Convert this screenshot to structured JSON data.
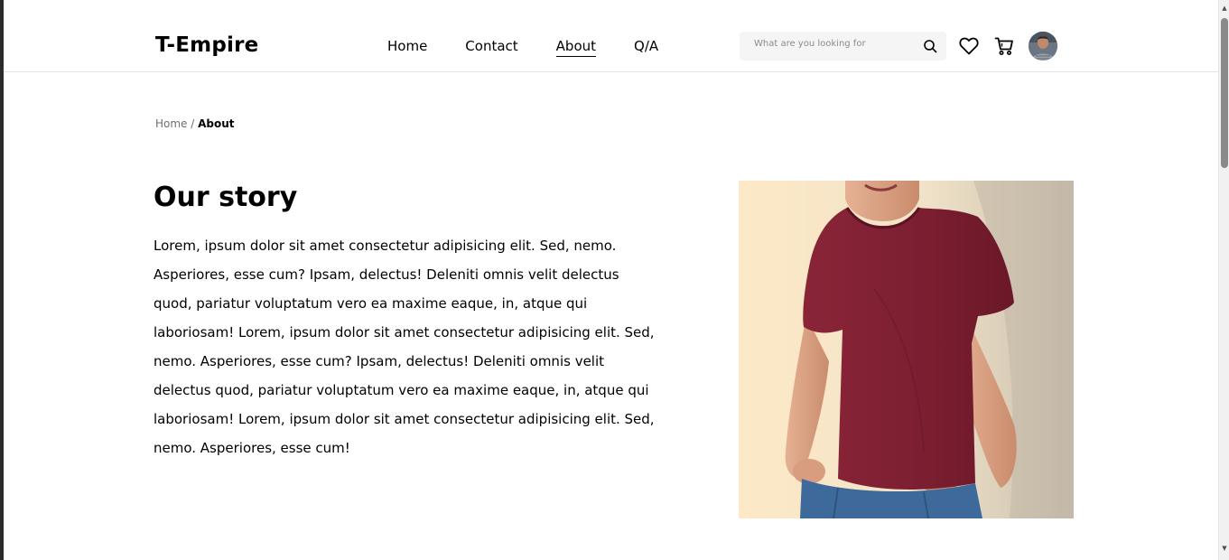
{
  "header": {
    "logo": "T-Empire",
    "nav": [
      {
        "label": "Home",
        "active": false
      },
      {
        "label": "Contact",
        "active": false
      },
      {
        "label": "About",
        "active": true
      },
      {
        "label": "Q/A",
        "active": false
      }
    ],
    "search": {
      "placeholder": "What are you looking for",
      "icon": "search-icon"
    },
    "icons": [
      "heart-icon",
      "cart-icon"
    ],
    "avatar": "user-avatar"
  },
  "breadcrumb": {
    "home": "Home",
    "separator": " / ",
    "current": "About"
  },
  "story": {
    "title": "Our story",
    "body": "Lorem, ipsum dolor sit amet consectetur adipisicing elit. Sed, nemo. Asperiores, esse cum? Ipsam, delectus! Deleniti omnis velit delectus quod, pariatur voluptatum vero ea maxime eaque, in, atque qui laboriosam! Lorem, ipsum dolor sit amet consectetur adipisicing elit. Sed, nemo. Asperiores, esse cum? Ipsam, delectus! Deleniti omnis velit delectus quod, pariatur voluptatum vero ea maxime eaque, in, atque qui laboriosam! Lorem, ipsum dolor sit amet consectetur adipisicing elit. Sed, nemo. Asperiores, esse cum!"
  },
  "colors": {
    "shirt": "#7e1f32",
    "background_photo": "#f3e6c8",
    "search_bg": "#f5f5f5"
  }
}
